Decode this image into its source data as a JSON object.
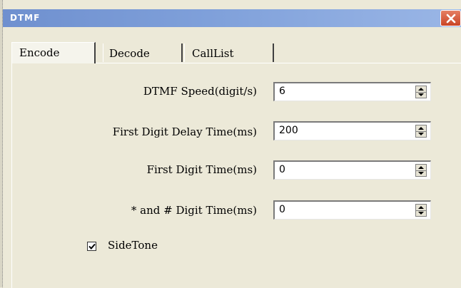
{
  "window": {
    "title": "DTMF"
  },
  "tabs": [
    {
      "label": "Encode"
    },
    {
      "label": "Decode"
    },
    {
      "label": "CallList"
    }
  ],
  "fields": [
    {
      "label": "DTMF Speed(digit/s)",
      "value": "6"
    },
    {
      "label": "First Digit Delay Time(ms)",
      "value": "200"
    },
    {
      "label": "First Digit Time(ms)",
      "value": "0"
    },
    {
      "label": "* and # Digit Time(ms)",
      "value": "0"
    }
  ],
  "sidetone": {
    "label": "SideTone",
    "checked": true
  },
  "icons": {
    "close": "close-icon",
    "spin_up": "arrow-up-icon",
    "spin_down": "arrow-down-icon",
    "check": "checkmark-icon"
  },
  "colors": {
    "titlebar": "#7fa0da",
    "close": "#d25a3d",
    "background": "#ece9d8"
  }
}
